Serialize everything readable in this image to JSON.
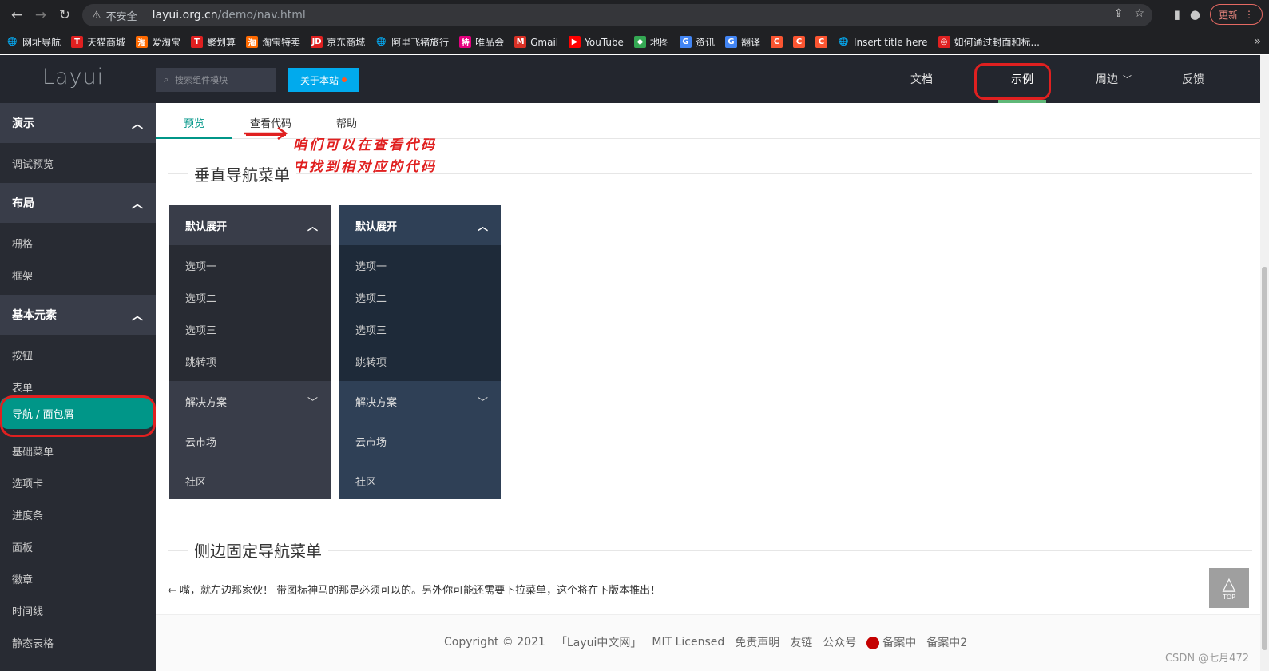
{
  "browser": {
    "insecure_label": "不安全",
    "url_host": "layui.org.cn",
    "url_path": "/demo/nav.html",
    "update_label": "更新",
    "bookmarks": [
      {
        "label": "网址导航",
        "color": "#202124",
        "glyph": "🌐"
      },
      {
        "label": "天猫商城",
        "color": "#e02020",
        "glyph": "T"
      },
      {
        "label": "爱淘宝",
        "color": "#ff6a00",
        "glyph": "淘"
      },
      {
        "label": "聚划算",
        "color": "#e02020",
        "glyph": "T"
      },
      {
        "label": "淘宝特卖",
        "color": "#ff6a00",
        "glyph": "淘"
      },
      {
        "label": "京东商城",
        "color": "#e02020",
        "glyph": "JD"
      },
      {
        "label": "阿里飞猪旅行",
        "color": "#202124",
        "glyph": "🌐"
      },
      {
        "label": "唯品会",
        "color": "#e5007f",
        "glyph": "特"
      },
      {
        "label": "Gmail",
        "color": "#d93025",
        "glyph": "M"
      },
      {
        "label": "YouTube",
        "color": "#ff0000",
        "glyph": "▶"
      },
      {
        "label": "地图",
        "color": "#34a853",
        "glyph": "◆"
      },
      {
        "label": "资讯",
        "color": "#4285f4",
        "glyph": "G"
      },
      {
        "label": "翻译",
        "color": "#4285f4",
        "glyph": "G"
      },
      {
        "label": "",
        "color": "#fc5531",
        "glyph": "C"
      },
      {
        "label": "",
        "color": "#fc5531",
        "glyph": "C"
      },
      {
        "label": "",
        "color": "#fc5531",
        "glyph": "C"
      },
      {
        "label": "Insert title here",
        "color": "#202124",
        "glyph": "🌐"
      },
      {
        "label": "如何通过封面和标...",
        "color": "#e02020",
        "glyph": "◎"
      }
    ]
  },
  "header": {
    "logo": "Layui",
    "search_placeholder": "搜索组件模块",
    "about_label": "关于本站",
    "nav": [
      "文档",
      "示例",
      "周边",
      "反馈"
    ]
  },
  "sidebar": {
    "groups": [
      "演示",
      "布局",
      "基本元素"
    ],
    "demo_items": [
      "调试预览"
    ],
    "layout_items": [
      "栅格",
      "框架"
    ],
    "element_items": [
      "按钮",
      "表单",
      "导航 / 面包屑",
      "基础菜单",
      "选项卡",
      "进度条",
      "面板",
      "徽章",
      "时间线",
      "静态表格"
    ]
  },
  "main": {
    "tabs": [
      "预览",
      "查看代码",
      "帮助"
    ],
    "annotation_line1": "咱们可以在查看代码",
    "annotation_line2": "中找到相对应的代码",
    "section1_title": "垂直导航菜单",
    "section2_title": "侧边固定导航菜单",
    "vnav": {
      "head": "默认展开",
      "items": [
        "选项一",
        "选项二",
        "选项三",
        "跳转项"
      ],
      "solution": "解决方案",
      "market": "云市场",
      "community": "社区"
    },
    "hint": "← 嘴，就左边那家伙！ 带图标神马的那是必须可以的。另外你可能还需要下拉菜单，这个将在下版本推出！",
    "top_btn": "TOP"
  },
  "footer": {
    "copyright": "Copyright © 2021",
    "site": "「Layui中文网」",
    "license": "MIT Licensed",
    "disclaimer": "免责声明",
    "links": "友链",
    "wechat": "公众号",
    "record1": "备案中",
    "record2": "备案中2"
  },
  "watermark": "CSDN @七月472",
  "colors": {
    "accent": "#009688",
    "header_bg": "#23262e",
    "sidebar_bg": "#393d49",
    "vnav_dark": "#393d49",
    "vnav_blue": "#2f4056",
    "annotation": "#e02020"
  }
}
